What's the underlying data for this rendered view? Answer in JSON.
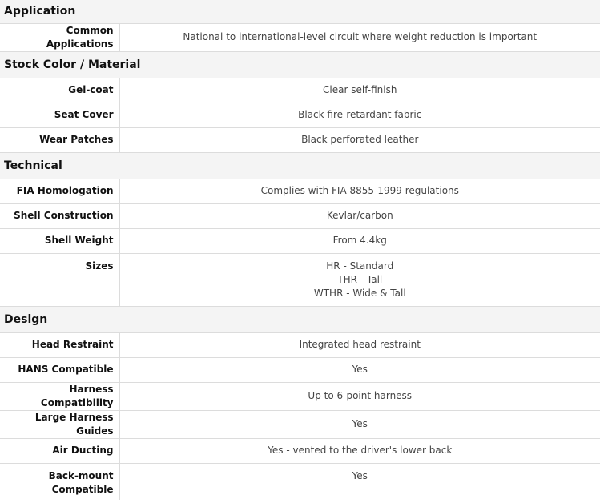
{
  "sections": {
    "application": {
      "title": "Application",
      "rows": [
        {
          "label": "Common Applications",
          "value": "National to international-level circuit where weight reduction is important"
        }
      ]
    },
    "stock": {
      "title": "Stock Color / Material",
      "rows": [
        {
          "label": "Gel-coat",
          "value": "Clear self-finish"
        },
        {
          "label": "Seat Cover",
          "value": "Black fire-retardant fabric"
        },
        {
          "label": "Wear Patches",
          "value": "Black perforated leather"
        }
      ]
    },
    "technical": {
      "title": "Technical",
      "rows": [
        {
          "label": "FIA Homologation",
          "value": "Complies with FIA 8855-1999 regulations"
        },
        {
          "label": "Shell Construction",
          "value": "Kevlar/carbon"
        },
        {
          "label": "Shell Weight",
          "value": "From 4.4kg"
        },
        {
          "label": "Sizes",
          "values": [
            "HR - Standard",
            "THR - Tall",
            "WTHR - Wide & Tall"
          ]
        }
      ]
    },
    "design": {
      "title": "Design",
      "rows": [
        {
          "label": "Head Restraint",
          "value": "Integrated head restraint"
        },
        {
          "label": "HANS Compatible",
          "value": "Yes"
        },
        {
          "label": "Harness Compatibility",
          "value": "Up to 6-point harness"
        },
        {
          "label": "Large Harness Guides",
          "value": "Yes"
        },
        {
          "label": "Air Ducting",
          "value": "Yes - vented to the driver's lower back"
        },
        {
          "label": "Back-mount Compatible",
          "value": "Yes"
        }
      ]
    }
  }
}
